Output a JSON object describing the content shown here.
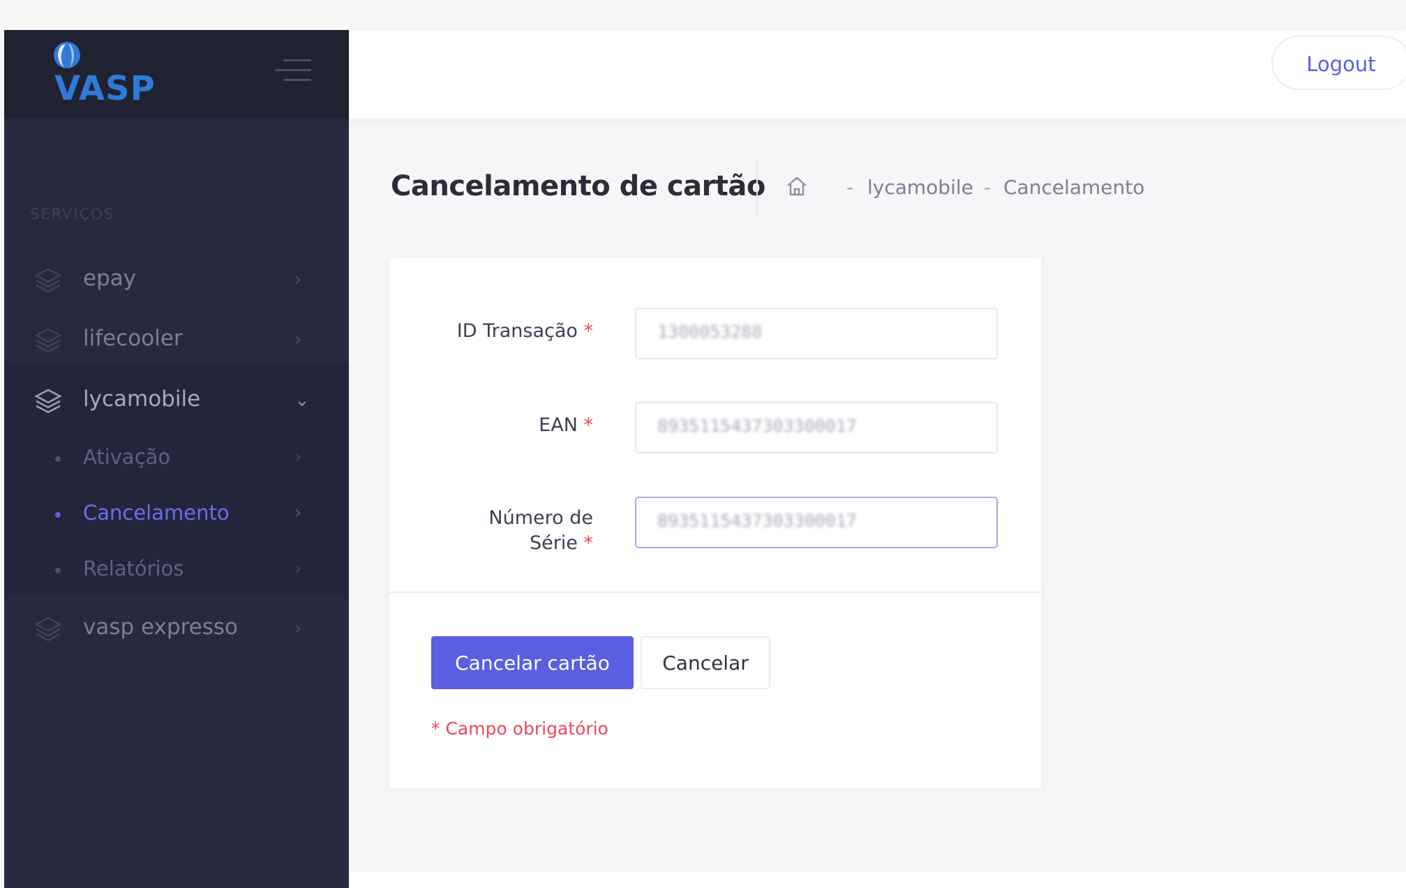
{
  "brand": {
    "logo_text": "VASP"
  },
  "header": {
    "logout_label": "Logout"
  },
  "sidebar": {
    "section_title": "SERVIÇOS",
    "items": [
      {
        "label": "epay"
      },
      {
        "label": "lifecooler"
      },
      {
        "label": "lycamobile"
      },
      {
        "label": "vasp expresso"
      }
    ],
    "subitems": [
      {
        "label": "Ativação"
      },
      {
        "label": "Cancelamento"
      },
      {
        "label": "Relatórios"
      }
    ]
  },
  "page": {
    "title": "Cancelamento de cartão",
    "breadcrumb": [
      "lycamobile",
      "Cancelamento"
    ],
    "breadcrumb_sep": "-"
  },
  "form": {
    "required_mark": "*",
    "fields": [
      {
        "label": "ID Transação",
        "value": "1300053288"
      },
      {
        "label": "EAN",
        "value": "8935115437303300017"
      },
      {
        "label_line1": "Número de",
        "label_line2": "Série",
        "value": "8935115437303300017"
      }
    ],
    "submit_label": "Cancelar cartão",
    "cancel_label": "Cancelar",
    "required_note": "* Campo obrigatório"
  },
  "colors": {
    "accent": "#5a5ee0",
    "sidebar": "#272a3d",
    "required": "#f0465a"
  }
}
